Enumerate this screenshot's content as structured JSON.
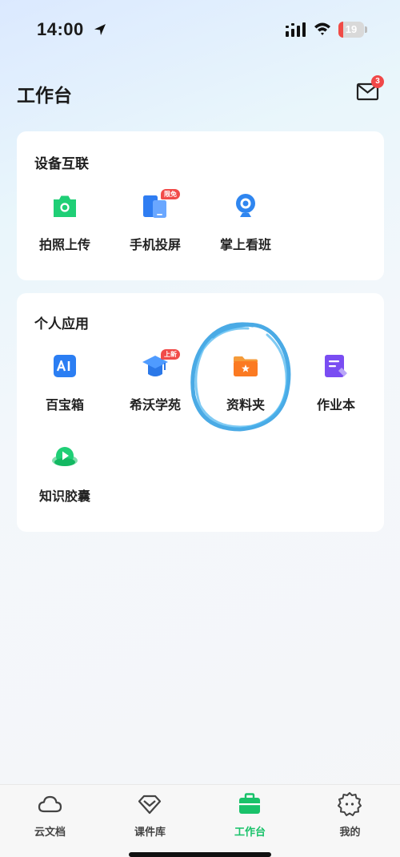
{
  "status_bar": {
    "time": "14:00",
    "battery": "19",
    "battery_level": 0.19
  },
  "header": {
    "title": "工作台",
    "mail_badge": "3"
  },
  "devices_section": {
    "title": "设备互联",
    "items": [
      {
        "label": "拍照上传",
        "icon": "camera-icon"
      },
      {
        "label": "手机投屏",
        "icon": "phone-cast-icon",
        "tag": "限免"
      },
      {
        "label": "掌上看班",
        "icon": "webcam-icon"
      }
    ]
  },
  "apps_section": {
    "title": "个人应用",
    "items": [
      {
        "label": "百宝箱",
        "icon": "ai-icon"
      },
      {
        "label": "希沃学苑",
        "icon": "graduation-cap-icon",
        "tag": "上新"
      },
      {
        "label": "资料夹",
        "icon": "folder-star-icon"
      },
      {
        "label": "作业本",
        "icon": "notebook-icon"
      },
      {
        "label": "知识胶囊",
        "icon": "capsule-play-icon"
      }
    ]
  },
  "tab_bar": {
    "tabs": [
      {
        "label": "云文档",
        "icon": "cloud-icon"
      },
      {
        "label": "课件库",
        "icon": "diamond-icon"
      },
      {
        "label": "工作台",
        "icon": "briefcase-icon",
        "active": true
      },
      {
        "label": "我的",
        "icon": "profile-face-icon"
      }
    ]
  },
  "colors": {
    "accent_green": "#19c26a",
    "badge_red": "#f04848",
    "annotation_blue": "#2a9be0"
  }
}
